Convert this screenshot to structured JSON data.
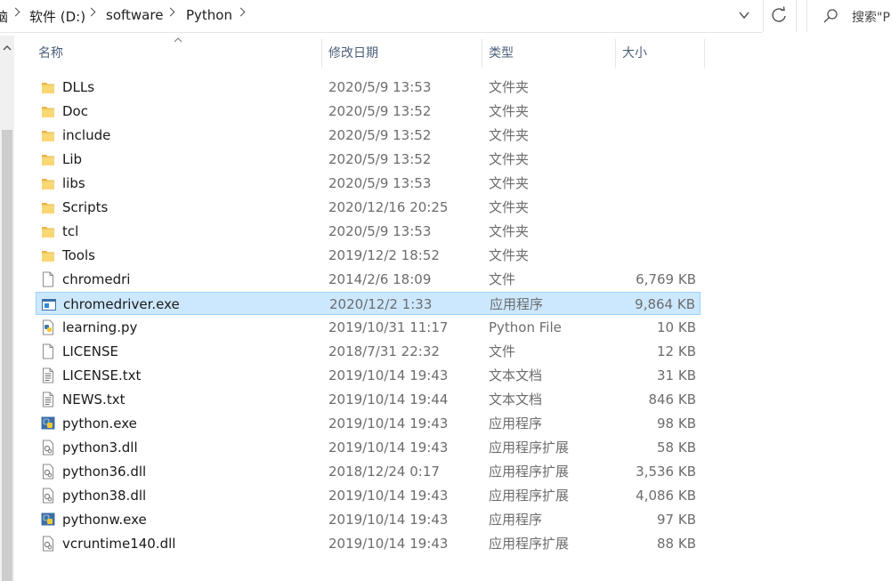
{
  "address": {
    "crumbs": [
      "脑",
      "软件 (D:)",
      "software",
      "Python"
    ],
    "search_placeholder": "搜索\"P"
  },
  "columns": {
    "name": "名称",
    "date": "修改日期",
    "type": "类型",
    "size": "大小"
  },
  "files": [
    {
      "name": "DLLs",
      "date": "2020/5/9 13:53",
      "type": "文件夹",
      "size": "",
      "icon": "folder-icon"
    },
    {
      "name": "Doc",
      "date": "2020/5/9 13:52",
      "type": "文件夹",
      "size": "",
      "icon": "folder-icon"
    },
    {
      "name": "include",
      "date": "2020/5/9 13:52",
      "type": "文件夹",
      "size": "",
      "icon": "folder-icon"
    },
    {
      "name": "Lib",
      "date": "2020/5/9 13:52",
      "type": "文件夹",
      "size": "",
      "icon": "folder-icon"
    },
    {
      "name": "libs",
      "date": "2020/5/9 13:53",
      "type": "文件夹",
      "size": "",
      "icon": "folder-icon"
    },
    {
      "name": "Scripts",
      "date": "2020/12/16 20:25",
      "type": "文件夹",
      "size": "",
      "icon": "folder-icon"
    },
    {
      "name": "tcl",
      "date": "2020/5/9 13:53",
      "type": "文件夹",
      "size": "",
      "icon": "folder-icon"
    },
    {
      "name": "Tools",
      "date": "2019/12/2 18:52",
      "type": "文件夹",
      "size": "",
      "icon": "folder-icon"
    },
    {
      "name": "chromedri",
      "date": "2014/2/6 18:09",
      "type": "文件",
      "size": "6,769 KB",
      "icon": "file-icon"
    },
    {
      "name": "chromedriver.exe",
      "date": "2020/12/2 1:33",
      "type": "应用程序",
      "size": "9,864 KB",
      "icon": "exe-icon",
      "selected": true
    },
    {
      "name": "learning.py",
      "date": "2019/10/31 11:17",
      "type": "Python File",
      "size": "10 KB",
      "icon": "python-file-icon"
    },
    {
      "name": "LICENSE",
      "date": "2018/7/31 22:32",
      "type": "文件",
      "size": "12 KB",
      "icon": "file-icon"
    },
    {
      "name": "LICENSE.txt",
      "date": "2019/10/14 19:43",
      "type": "文本文档",
      "size": "31 KB",
      "icon": "text-file-icon"
    },
    {
      "name": "NEWS.txt",
      "date": "2019/10/14 19:44",
      "type": "文本文档",
      "size": "846 KB",
      "icon": "text-file-icon"
    },
    {
      "name": "python.exe",
      "date": "2019/10/14 19:43",
      "type": "应用程序",
      "size": "98 KB",
      "icon": "python-exe-icon"
    },
    {
      "name": "python3.dll",
      "date": "2019/10/14 19:43",
      "type": "应用程序扩展",
      "size": "58 KB",
      "icon": "dll-icon"
    },
    {
      "name": "python36.dll",
      "date": "2018/12/24 0:17",
      "type": "应用程序扩展",
      "size": "3,536 KB",
      "icon": "dll-icon"
    },
    {
      "name": "python38.dll",
      "date": "2019/10/14 19:43",
      "type": "应用程序扩展",
      "size": "4,086 KB",
      "icon": "dll-icon"
    },
    {
      "name": "pythonw.exe",
      "date": "2019/10/14 19:43",
      "type": "应用程序",
      "size": "97 KB",
      "icon": "python-exe-icon"
    },
    {
      "name": "vcruntime140.dll",
      "date": "2019/10/14 19:43",
      "type": "应用程序扩展",
      "size": "88 KB",
      "icon": "dll-icon"
    }
  ],
  "colors": {
    "selection_bg": "#cce8ff",
    "selection_border": "#99d1ff",
    "folder": "#f8d775",
    "header_text": "#4c607a"
  }
}
